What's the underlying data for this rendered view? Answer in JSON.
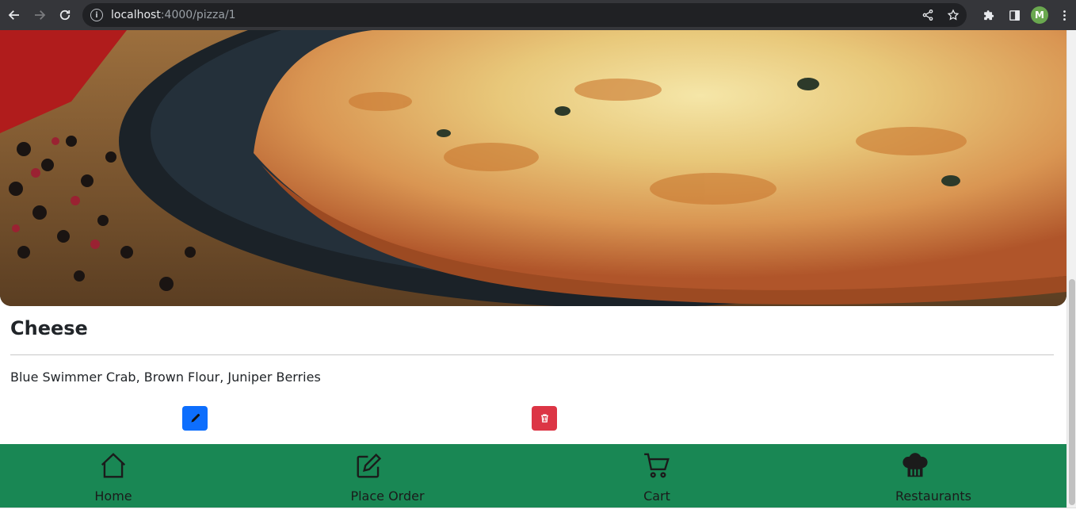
{
  "browser": {
    "url_host": "localhost",
    "url_path": ":4000/pizza/1",
    "avatar_letter": "M"
  },
  "pizza": {
    "name": "Cheese",
    "ingredients": "Blue Swimmer Crab, Brown Flour, Juniper Berries"
  },
  "actions": {
    "edit_icon": "pencil-icon",
    "delete_icon": "trash-icon"
  },
  "bottom_nav": {
    "items": [
      {
        "label": "Home",
        "icon": "home-icon"
      },
      {
        "label": "Place Order",
        "icon": "pencil-square-icon"
      },
      {
        "label": "Cart",
        "icon": "cart-icon"
      },
      {
        "label": "Restaurants",
        "icon": "chef-hat-icon"
      }
    ]
  },
  "colors": {
    "nav_bg": "#198754",
    "edit_btn": "#0d6efd",
    "delete_btn": "#dc3545"
  }
}
